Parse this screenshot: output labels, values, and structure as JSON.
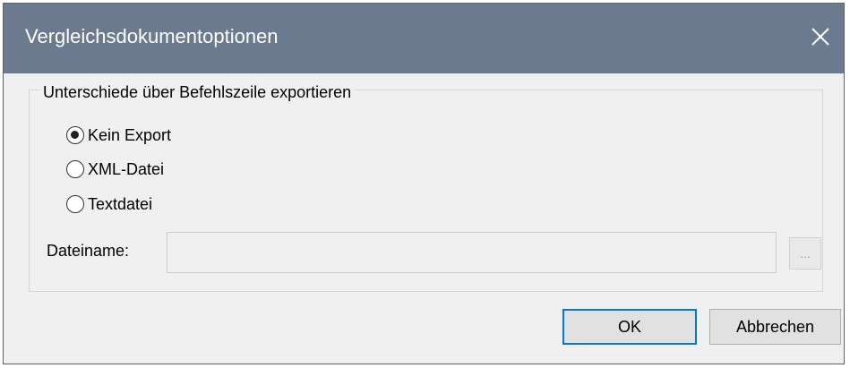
{
  "dialog": {
    "title": "Vergleichsdokumentoptionen",
    "close_icon": "close-icon"
  },
  "export_group": {
    "legend": "Unterschiede über Befehlszeile exportieren",
    "options": [
      {
        "label": "Kein Export",
        "checked": true
      },
      {
        "label": "XML-Datei",
        "checked": false
      },
      {
        "label": "Textdatei",
        "checked": false
      }
    ],
    "filename_label": "Dateiname:",
    "filename_value": "",
    "browse_label": "..."
  },
  "buttons": {
    "ok_label": "OK",
    "cancel_label": "Abbrechen"
  },
  "colors": {
    "titlebar": "#6c7a90",
    "focus_border": "#0078d7"
  }
}
